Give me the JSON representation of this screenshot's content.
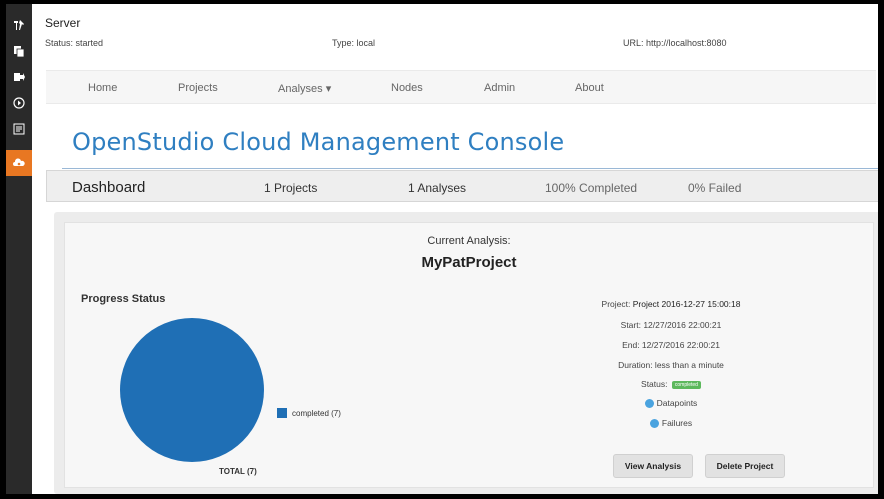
{
  "server": {
    "title": "Server",
    "status": "Status: started",
    "type": "Type: local",
    "url": "URL: http://localhost:8080"
  },
  "nav": {
    "home": "Home",
    "projects": "Projects",
    "analyses": "Analyses ▾",
    "nodes": "Nodes",
    "admin": "Admin",
    "about": "About"
  },
  "page_title": "OpenStudio Cloud Management Console",
  "dashboard": {
    "label": "Dashboard",
    "projects": "1 Projects",
    "analyses": "1 Analyses",
    "completed": "100% Completed",
    "failed": "0% Failed"
  },
  "analysis": {
    "current_label": "Current Analysis:",
    "project_name": "MyPatProject",
    "progress_label": "Progress Status",
    "legend_label": "completed (7)",
    "total_label": "TOTAL (7)",
    "project_line_prefix": "Project: ",
    "project_line_value": "Project 2016-12-27 15:00:18",
    "start": "Start: 12/27/2016 22:00:21",
    "end": "End: 12/27/2016 22:00:21",
    "duration": "Duration: less than a minute",
    "status_prefix": "Status:",
    "status_badge": "completed",
    "datapoints_label": "Datapoints",
    "failures_label": "Failures",
    "view_button": "View Analysis",
    "delete_button": "Delete Project"
  },
  "chart_data": {
    "type": "pie",
    "slices": [
      {
        "name": "completed",
        "value": 7
      }
    ],
    "colors": [
      "#1f6fb5"
    ],
    "title": "Progress Status"
  },
  "icons": {
    "sidebar": [
      "tools-icon",
      "documents-icon",
      "export-icon",
      "play-icon",
      "monitor-icon",
      "cloud-icon"
    ],
    "info": [
      "datapoints-icon",
      "failures-icon"
    ]
  },
  "colors": {
    "accent": "#2f7fc1",
    "active_sidebar": "#e87722",
    "status_completed": "#5cb85c",
    "badge": "#4aa3df"
  }
}
